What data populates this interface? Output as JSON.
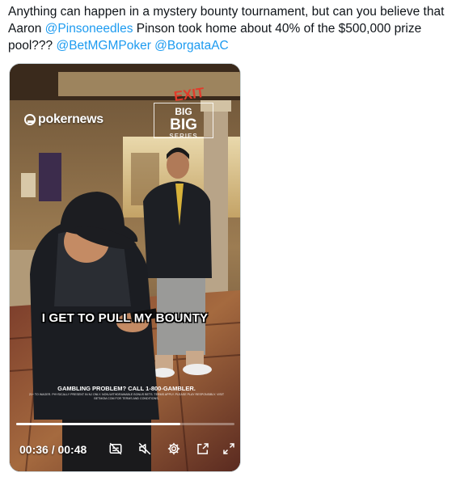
{
  "tweet": {
    "text_part1": "Anything can happen in a mystery bounty tournament, but can you believe that Aaron ",
    "mention1": "@Pinsoneedles",
    "text_part2": " Pinson took home about 40% of the $500,000 prize pool??? ",
    "mention2": "@BetMGMPoker",
    "mention3": "@BorgataAC"
  },
  "video": {
    "logo_text": "pokernews",
    "badge": {
      "line1": "BIG",
      "line2": "BIG",
      "line3": "SERIES"
    },
    "exit_sign": "EXIT",
    "caption": "I GET TO PULL MY BOUNTY",
    "disclaimer_title": "GAMBLING PROBLEM? CALL 1-800-GAMBLER.",
    "disclaimer_body": "21+ TO WAGER. PHYSICALLY PRESENT IN NJ ONLY. NON-WITHDRAWABLE BONUS BETS. TERMS APPLY. PLEASE PLAY RESPONSIBLY. VISIT BETMGM.COM FOR TERMS AND CONDITIONS.",
    "progress_fraction": 0.75,
    "time_display": "00:36 / 00:48",
    "icons": [
      "captions-icon",
      "mute-icon",
      "settings-icon",
      "picture-in-picture-icon",
      "fullscreen-icon"
    ]
  }
}
